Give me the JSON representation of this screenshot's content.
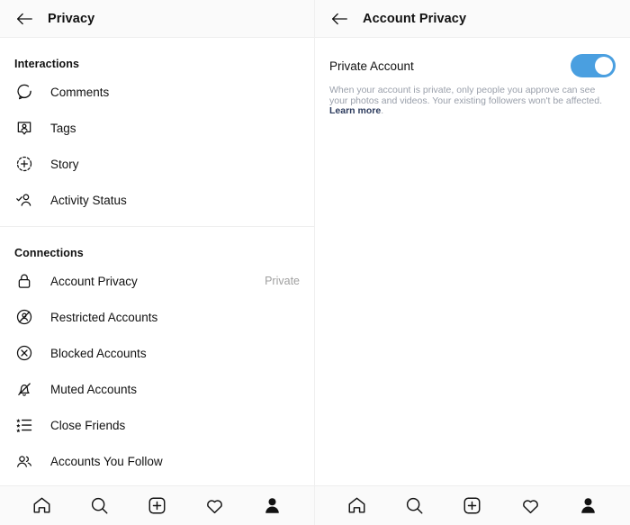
{
  "left_panel": {
    "header": {
      "title": "Privacy",
      "back_icon": "arrow-left-icon"
    },
    "sections": [
      {
        "label": "Interactions",
        "items": [
          {
            "label": "Comments",
            "icon": "comment-bubble-icon",
            "value": ""
          },
          {
            "label": "Tags",
            "icon": "tag-person-icon",
            "value": ""
          },
          {
            "label": "Story",
            "icon": "story-plus-circle-icon",
            "value": ""
          },
          {
            "label": "Activity Status",
            "icon": "activity-status-person-check-icon",
            "value": ""
          }
        ]
      },
      {
        "label": "Connections",
        "items": [
          {
            "label": "Account Privacy",
            "icon": "lock-icon",
            "value": "Private"
          },
          {
            "label": "Restricted Accounts",
            "icon": "restricted-person-slash-icon",
            "value": ""
          },
          {
            "label": "Blocked Accounts",
            "icon": "blocked-x-circle-icon",
            "value": ""
          },
          {
            "label": "Muted Accounts",
            "icon": "muted-bell-slash-icon",
            "value": ""
          },
          {
            "label": "Close Friends",
            "icon": "close-friends-star-list-icon",
            "value": ""
          },
          {
            "label": "Accounts You Follow",
            "icon": "people-group-icon",
            "value": ""
          }
        ]
      }
    ]
  },
  "right_panel": {
    "header": {
      "title": "Account Privacy",
      "back_icon": "arrow-left-icon"
    },
    "private_account": {
      "label": "Private Account",
      "toggle_state": "on",
      "toggle_color": "#4a9fe0",
      "description_text": "When your account is private, only people you approve can see your photos and videos. Your existing followers won't be affected. ",
      "learn_more_label": "Learn more",
      "description_suffix": "."
    }
  },
  "bottom_nav": {
    "items": [
      {
        "icon": "home-icon",
        "label": "Home"
      },
      {
        "icon": "search-icon",
        "label": "Search"
      },
      {
        "icon": "add-post-icon",
        "label": "Create"
      },
      {
        "icon": "heart-icon",
        "label": "Activity"
      },
      {
        "icon": "profile-person-icon",
        "label": "Profile"
      }
    ]
  },
  "colors": {
    "accent": "#4a9fe0",
    "header_bg": "#fafafa",
    "text_primary": "#111111",
    "text_muted": "#a0a0a0",
    "link": "#2b3a5c",
    "divider": "#efefef"
  }
}
